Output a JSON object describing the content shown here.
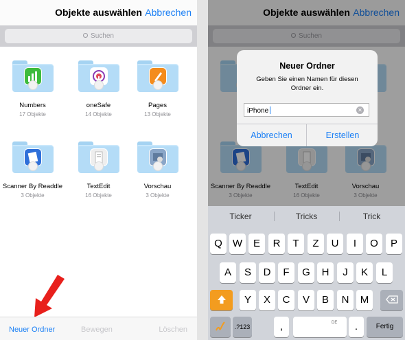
{
  "left_screen": {
    "nav": {
      "title": "Objekte auswählen",
      "cancel": "Abbrechen"
    },
    "search": {
      "placeholder": "Suchen",
      "icon": "magnifier-icon"
    },
    "items": [
      {
        "name": "Numbers",
        "count": "17 Objekte",
        "icon": "numbers-app-icon",
        "color": "#3dbb3c",
        "glyph": "▮"
      },
      {
        "name": "oneSafe",
        "count": "14 Objekte",
        "icon": "onesafe-app-icon",
        "color": "#ffffff",
        "glyph": "●"
      },
      {
        "name": "Pages",
        "count": "13 Objekte",
        "icon": "pages-app-icon",
        "color": "#f48c1c",
        "glyph": "✎"
      },
      {
        "name": "Scanner By Readdle",
        "count": "3 Objekte",
        "icon": "scanner-app-icon",
        "color": "#2e6fd9",
        "glyph": "▤"
      },
      {
        "name": "TextEdit",
        "count": "16 Objekte",
        "icon": "textedit-app-icon",
        "color": "#eeeeee",
        "glyph": "✎"
      },
      {
        "name": "Vorschau",
        "count": "3 Objekte",
        "icon": "vorschau-app-icon",
        "color": "#8aa6c8",
        "glyph": "▧"
      }
    ],
    "toolbar": {
      "new_folder": "Neuer Ordner",
      "move": "Bewegen",
      "delete": "Löschen"
    }
  },
  "right_screen": {
    "nav": {
      "title": "Objekte auswählen",
      "cancel": "Abbrechen"
    },
    "search": {
      "placeholder": "Suchen"
    },
    "items": [
      {
        "name": "Scanner By Readdle",
        "count": "3 Objekte"
      },
      {
        "name": "TextEdit",
        "count": "16 Objekte"
      },
      {
        "name": "Vorschau",
        "count": "3 Objekte"
      }
    ],
    "alert": {
      "title": "Neuer Ordner",
      "message": "Geben Sie einen Namen für diesen Ordner ein.",
      "input_value": "iPhone",
      "cancel": "Abbrechen",
      "create": "Erstellen"
    },
    "suggestions": [
      "Ticker",
      "Tricks",
      "Trick"
    ],
    "keyboard": {
      "row1": [
        "Q",
        "W",
        "E",
        "R",
        "T",
        "Z",
        "U",
        "I",
        "O",
        "P"
      ],
      "row2": [
        "A",
        "S",
        "D",
        "F",
        "G",
        "H",
        "J",
        "K",
        "L"
      ],
      "row3": [
        "Y",
        "X",
        "C",
        "V",
        "B",
        "N",
        "M"
      ],
      "numbers_key": ".?123",
      "comma": ",",
      "space_label": "DE",
      "period": ".",
      "done": "Fertig",
      "shift_icon": "shift-arrow-icon",
      "backspace_icon": "backspace-icon",
      "emoji_icon": "handwriting-icon"
    }
  }
}
